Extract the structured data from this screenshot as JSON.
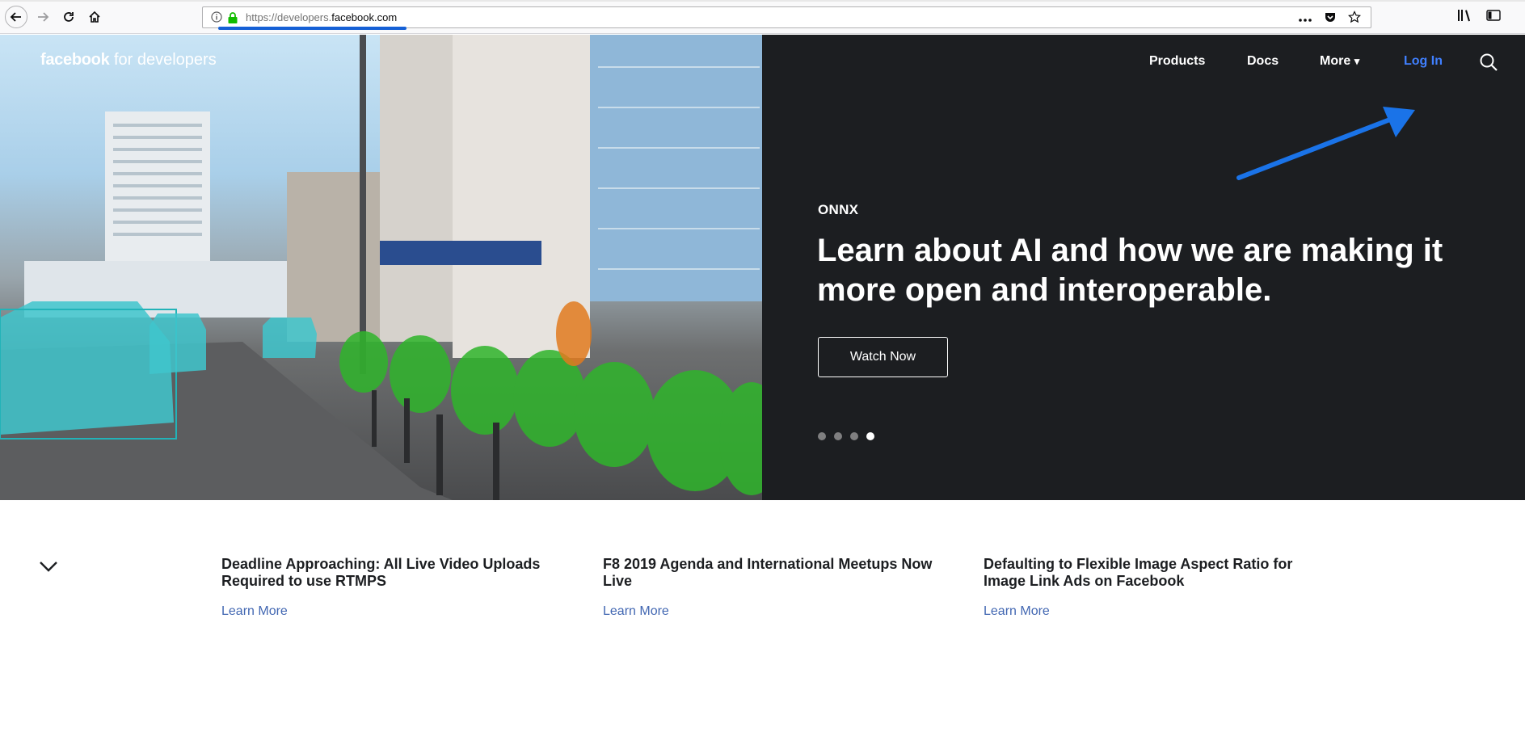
{
  "browser": {
    "url_prefix": "https://developers.",
    "url_host": "facebook.com",
    "icons": [
      "back-icon",
      "forward-icon",
      "reload-icon",
      "home-icon",
      "info-icon",
      "lock-icon",
      "more-icon",
      "pocket-icon",
      "bookmark-star-icon",
      "library-icon",
      "sidebar-icon"
    ]
  },
  "header": {
    "logo_bold": "facebook",
    "logo_rest": " for developers",
    "nav": {
      "products": "Products",
      "docs": "Docs",
      "more": "More",
      "more_caret": "▾",
      "login": "Log In"
    },
    "annotation": "blue-arrow-pointing-to-login"
  },
  "hero": {
    "eyebrow": "ONNX",
    "headline": "Learn about AI and how we are making it more open and interoperable.",
    "cta": "Watch Now",
    "slides_total": 4,
    "active_slide": 4
  },
  "news": [
    {
      "title": "Deadline Approaching: All Live Video Uploads Required to use RTMPS",
      "link": "Learn More"
    },
    {
      "title": "F8 2019 Agenda and International Meetups Now Live",
      "link": "Learn More"
    },
    {
      "title": "Defaulting to Flexible Image Aspect Ratio for Image Link Ads on Facebook",
      "link": "Learn More"
    }
  ],
  "colors": {
    "hero_bg": "#1c1e21",
    "login_blue": "#4080ff",
    "link_blue": "#4267b2",
    "annotation_arrow": "#1a73e8"
  }
}
